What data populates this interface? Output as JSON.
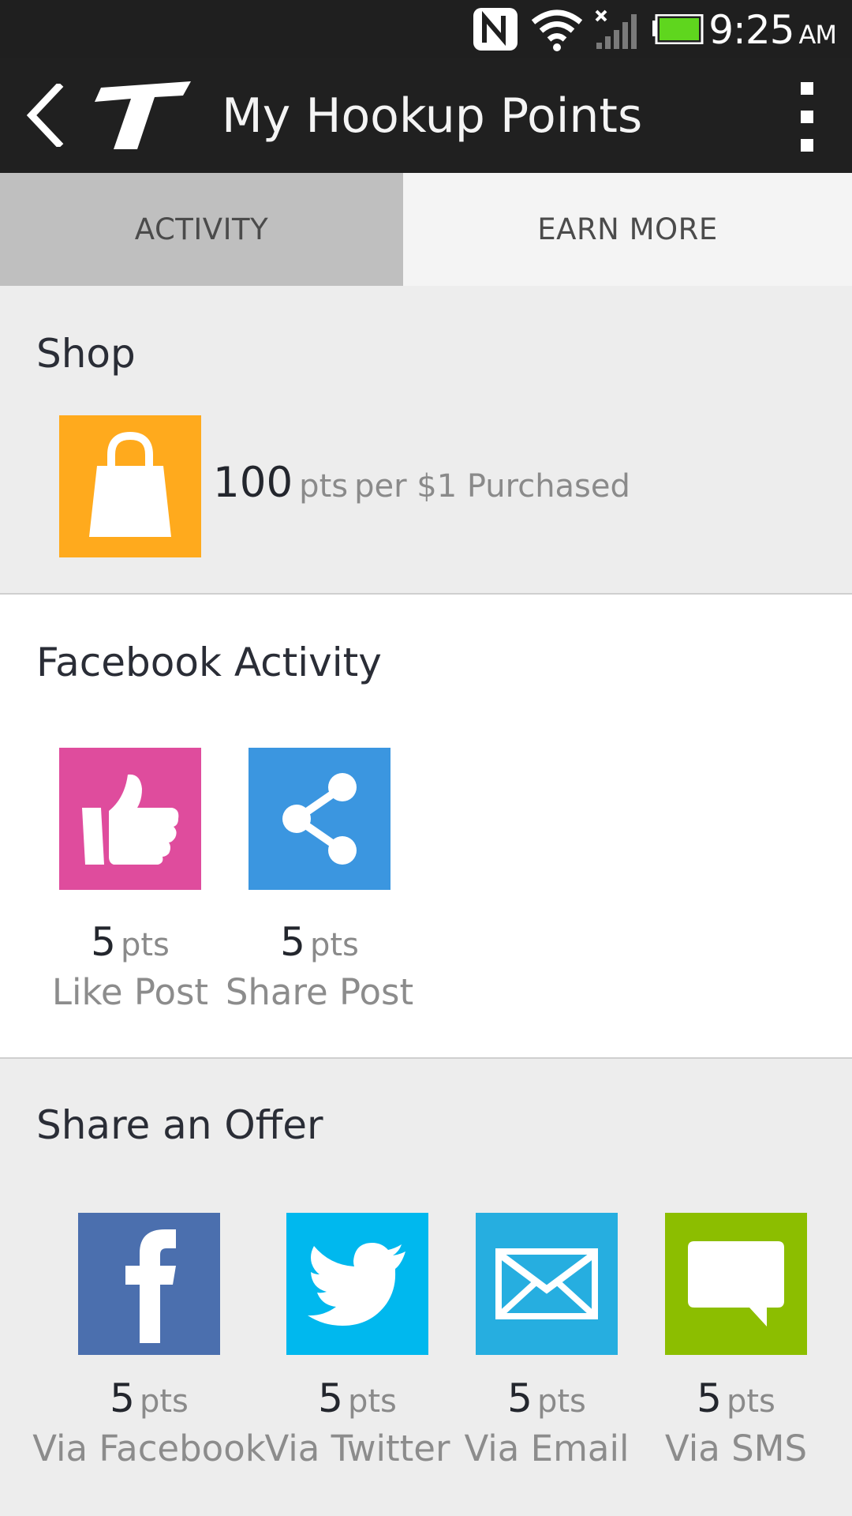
{
  "status_bar": {
    "time": "9:25",
    "ampm": "AM",
    "icons": [
      "nfc-icon",
      "wifi-icon",
      "cellular-signal-icon",
      "battery-icon"
    ],
    "battery_color": "#5fd61e"
  },
  "app_bar": {
    "title": "My Hookup Points",
    "icons": [
      "back-icon",
      "logo-icon",
      "overflow-menu-icon"
    ]
  },
  "tabs": [
    {
      "label": "ACTIVITY",
      "selected": true
    },
    {
      "label": "EARN MORE",
      "selected": false
    }
  ],
  "shop": {
    "title": "Shop",
    "points": "100",
    "unit": "pts",
    "description": "per $1 Purchased",
    "icon": "shopping-bag-icon",
    "color": "#ffaa1d"
  },
  "facebook_activity": {
    "title": "Facebook Activity",
    "items": [
      {
        "points": "5",
        "unit": "pts",
        "label": "Like Post",
        "icon": "thumbs-up-icon",
        "color": "#df4c9d"
      },
      {
        "points": "5",
        "unit": "pts",
        "label": "Share Post",
        "icon": "share-icon",
        "color": "#3b96e0"
      }
    ]
  },
  "share_offer": {
    "title": "Share an Offer",
    "items": [
      {
        "points": "5",
        "unit": "pts",
        "label": "Via Facebook",
        "icon": "facebook-icon",
        "color": "#4b6fae"
      },
      {
        "points": "5",
        "unit": "pts",
        "label": "Via Twitter",
        "icon": "twitter-icon",
        "color": "#00b8ee"
      },
      {
        "points": "5",
        "unit": "pts",
        "label": "Via Email",
        "icon": "email-icon",
        "color": "#26aee0"
      },
      {
        "points": "5",
        "unit": "pts",
        "label": "Via SMS",
        "icon": "sms-icon",
        "color": "#8cbe00"
      }
    ]
  }
}
